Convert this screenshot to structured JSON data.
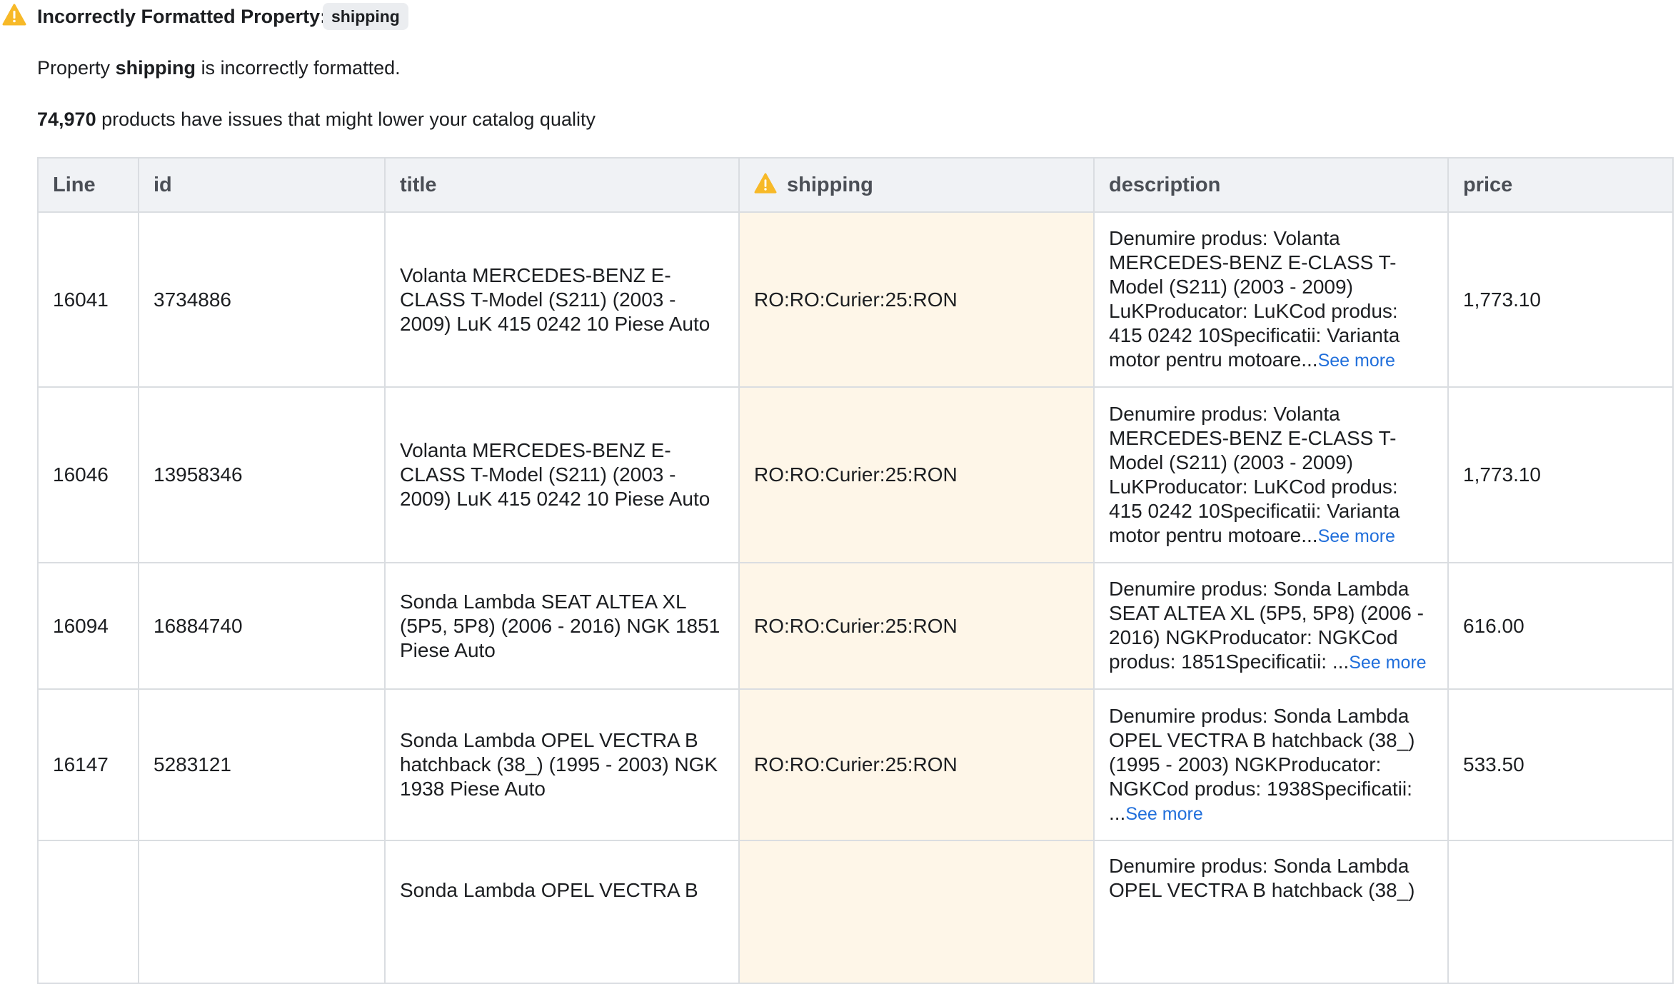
{
  "header": {
    "title": "Incorrectly Formatted Property:",
    "property": "shipping"
  },
  "message": {
    "prefix": "Property",
    "property": "shipping",
    "suffix": "is incorrectly formatted."
  },
  "summary": {
    "count": "74,970",
    "text": "products have issues that might lower your catalog quality"
  },
  "table": {
    "columns": [
      "Line",
      "id",
      "title",
      "shipping",
      "description",
      "price"
    ],
    "see_more_label": "See more",
    "rows": [
      {
        "line": "16041",
        "id": "3734886",
        "title": "Volanta MERCEDES-BENZ E-CLASS T-Model (S211) (2003 - 2009) LuK 415 0242 10 Piese Auto",
        "shipping": "RO:RO:Curier:25:RON",
        "description": "Denumire produs: Volanta MERCEDES-BENZ E-CLASS T-Model (S211) (2003 - 2009) LuKProducator: LuKCod produs: 415 0242 10Specificatii: Varianta motor pentru motoare...",
        "price": "1,773.10"
      },
      {
        "line": "16046",
        "id": "13958346",
        "title": "Volanta MERCEDES-BENZ E-CLASS T-Model (S211) (2003 - 2009) LuK 415 0242 10 Piese Auto",
        "shipping": "RO:RO:Curier:25:RON",
        "description": "Denumire produs: Volanta MERCEDES-BENZ E-CLASS T-Model (S211) (2003 - 2009) LuKProducator: LuKCod produs: 415 0242 10Specificatii: Varianta motor pentru motoare...",
        "price": "1,773.10"
      },
      {
        "line": "16094",
        "id": "16884740",
        "title": "Sonda Lambda SEAT ALTEA XL (5P5, 5P8) (2006 - 2016) NGK 1851 Piese Auto",
        "shipping": "RO:RO:Curier:25:RON",
        "description": "Denumire produs: Sonda Lambda SEAT ALTEA XL (5P5, 5P8) (2006 - 2016) NGKProducator: NGKCod produs: 1851Specificatii: ...",
        "price": "616.00"
      },
      {
        "line": "16147",
        "id": "5283121",
        "title": "Sonda Lambda OPEL VECTRA B hatchback (38_) (1995 - 2003) NGK 1938 Piese Auto",
        "shipping": "RO:RO:Curier:25:RON",
        "description": "Denumire produs: Sonda Lambda OPEL VECTRA B hatchback (38_) (1995 - 2003) NGKProducator: NGKCod produs: 1938Specificatii: ...",
        "price": "533.50"
      },
      {
        "line": "",
        "id": "",
        "title": "Sonda Lambda OPEL VECTRA B",
        "shipping": "",
        "description": "Denumire produs: Sonda Lambda OPEL VECTRA B hatchback (38_)",
        "price": ""
      }
    ]
  },
  "colors": {
    "warning": "#f7b928",
    "highlight_bg": "#fef6e8",
    "link": "#216fdb",
    "header_bg": "#f0f2f5",
    "border": "#dadde1"
  },
  "icons": {
    "header": "warning-triangle-icon",
    "column": "warning-triangle-icon"
  }
}
